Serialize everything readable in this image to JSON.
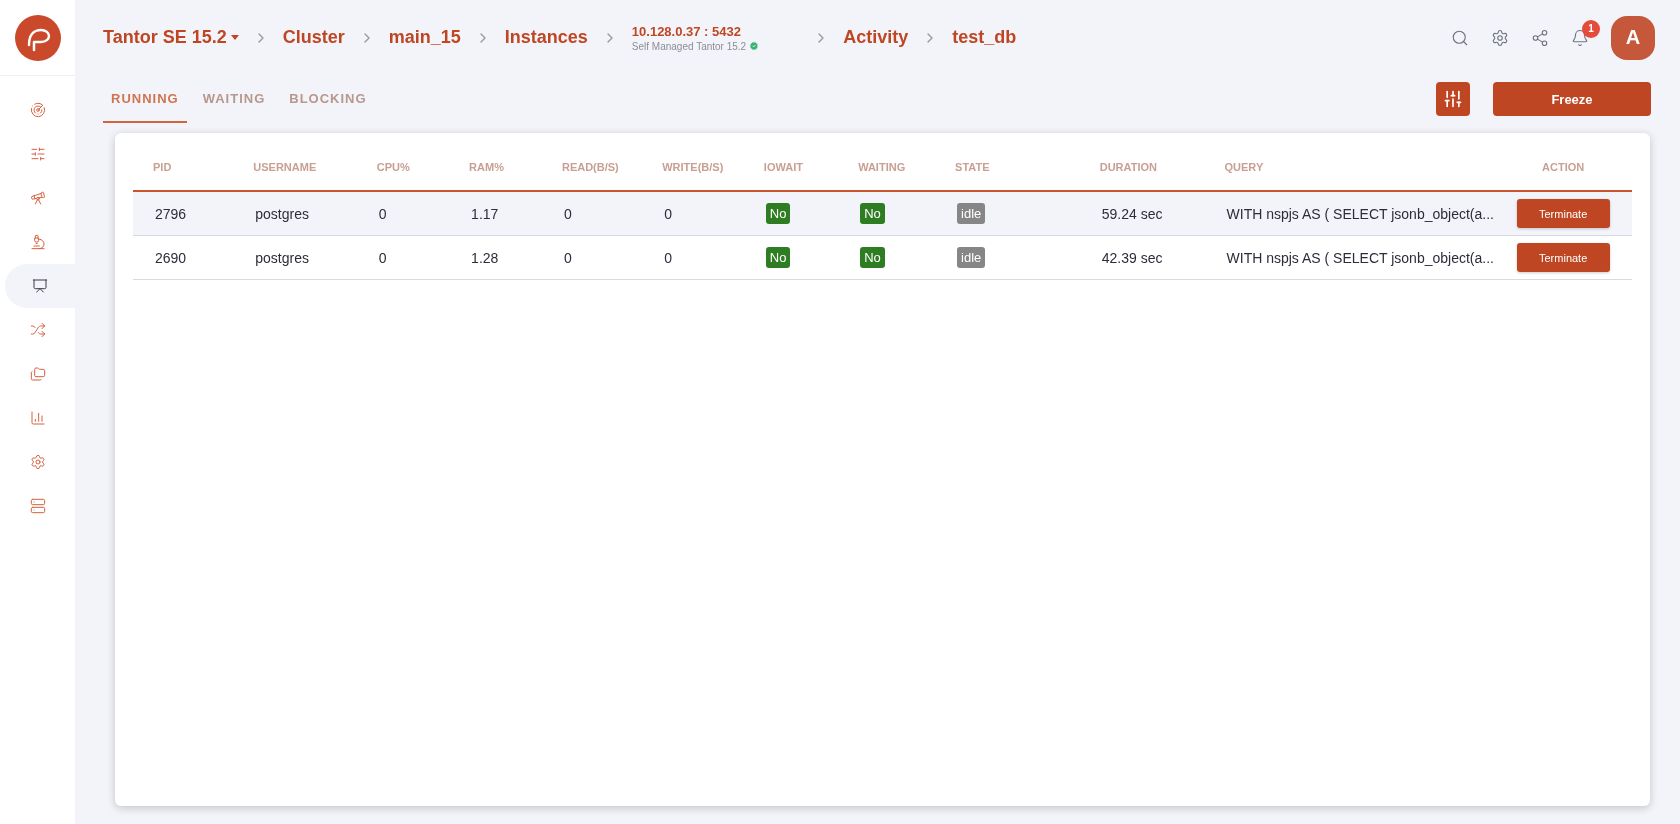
{
  "breadcrumbs": [
    {
      "kind": "dropdown",
      "label": "Tantor SE 15.2"
    },
    {
      "kind": "link",
      "label": "Cluster"
    },
    {
      "kind": "link",
      "label": "main_15"
    },
    {
      "kind": "link",
      "label": "Instances"
    },
    {
      "kind": "instance",
      "label": "10.128.0.37 : 5432",
      "subtitle": "Self Managed Tantor 15.2",
      "verified": true
    },
    {
      "kind": "link",
      "label": "Activity"
    },
    {
      "kind": "link",
      "label": "test_db"
    }
  ],
  "header": {
    "notifications": "1",
    "avatar": "A"
  },
  "sidebar": {
    "items": [
      {
        "selected": false
      },
      {
        "selected": false
      },
      {
        "selected": false
      },
      {
        "selected": false
      },
      {
        "selected": true
      },
      {
        "selected": false
      },
      {
        "selected": false
      },
      {
        "selected": false
      },
      {
        "selected": false
      },
      {
        "selected": false
      }
    ]
  },
  "tabs": [
    {
      "label": "RUNNING",
      "selected": true
    },
    {
      "label": "WAITING",
      "selected": false
    },
    {
      "label": "BLOCKING",
      "selected": false
    }
  ],
  "toolbar": {
    "freeze": "Freeze"
  },
  "table": {
    "columns": [
      "PID",
      "USERNAME",
      "CPU%",
      "RAM%",
      "READ(B/S)",
      "WRITE(B/S)",
      "IOWAIT",
      "WAITING",
      "STATE",
      "DURATION",
      "QUERY",
      "ACTION"
    ],
    "rows": [
      {
        "selected": true,
        "pid": "2796",
        "username": "postgres",
        "cpu": "0",
        "ram": "1.17",
        "read": "0",
        "write": "0",
        "iowait": "No",
        "waiting": "No",
        "state": "idle",
        "duration": "59.24 sec",
        "query": "WITH nspjs AS ( SELECT jsonb_object(a...",
        "action": "Terminate"
      },
      {
        "selected": false,
        "pid": "2690",
        "username": "postgres",
        "cpu": "0",
        "ram": "1.28",
        "read": "0",
        "write": "0",
        "iowait": "No",
        "waiting": "No",
        "state": "idle",
        "duration": "42.39 sec",
        "query": "WITH nspjs AS ( SELECT jsonb_object(a...",
        "action": "Terminate"
      }
    ]
  }
}
